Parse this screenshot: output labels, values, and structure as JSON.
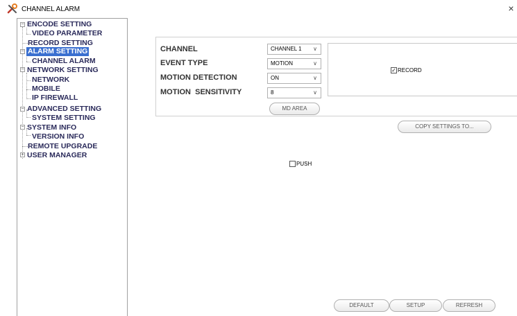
{
  "window": {
    "title": "CHANNEL ALARM",
    "close_glyph": "×",
    "icon": "settings-tools-icon"
  },
  "tree": {
    "encode_setting": "ENCODE SETTING",
    "video_parameter": "VIDEO PARAMETER",
    "record_setting": "RECORD SETTING",
    "alarm_setting": "ALARM SETTING",
    "channel_alarm": "CHANNEL ALARM",
    "network_setting": "NETWORK SETTING",
    "network": "NETWORK",
    "mobile": "MOBILE",
    "ip_firewall": "IP FIREWALL",
    "advanced_setting": "ADVANCED SETTING",
    "system_setting": "SYSTEM SETTING",
    "system_info": "SYSTEM INFO",
    "version_info": "VERSION INFO",
    "remote_upgrade": "REMOTE UPGRADE",
    "user_manager": "USER MANAGER",
    "selected": "ALARM SETTING"
  },
  "form": {
    "channel_label": "CHANNEL",
    "channel_value": "CHANNEL 1",
    "event_type_label": "EVENT TYPE",
    "event_type_value": "MOTION",
    "motion_detection_label": "MOTION DETECTION",
    "motion_detection_value": "ON",
    "motion_sensitivity_label": "MOTION  SENSITIVITY",
    "motion_sensitivity_value": "8",
    "md_area_label": "MD AREA"
  },
  "record": {
    "label": "RECORD",
    "checked": true
  },
  "push": {
    "label": "PUSH",
    "checked": false
  },
  "buttons": {
    "copy_settings": "COPY SETTINGS TO...",
    "default": "DEFAULT",
    "setup": "SETUP",
    "refresh": "REFRESH"
  },
  "colors": {
    "selection": "#3a6fd0",
    "tree_text": "#2a2a5a"
  }
}
